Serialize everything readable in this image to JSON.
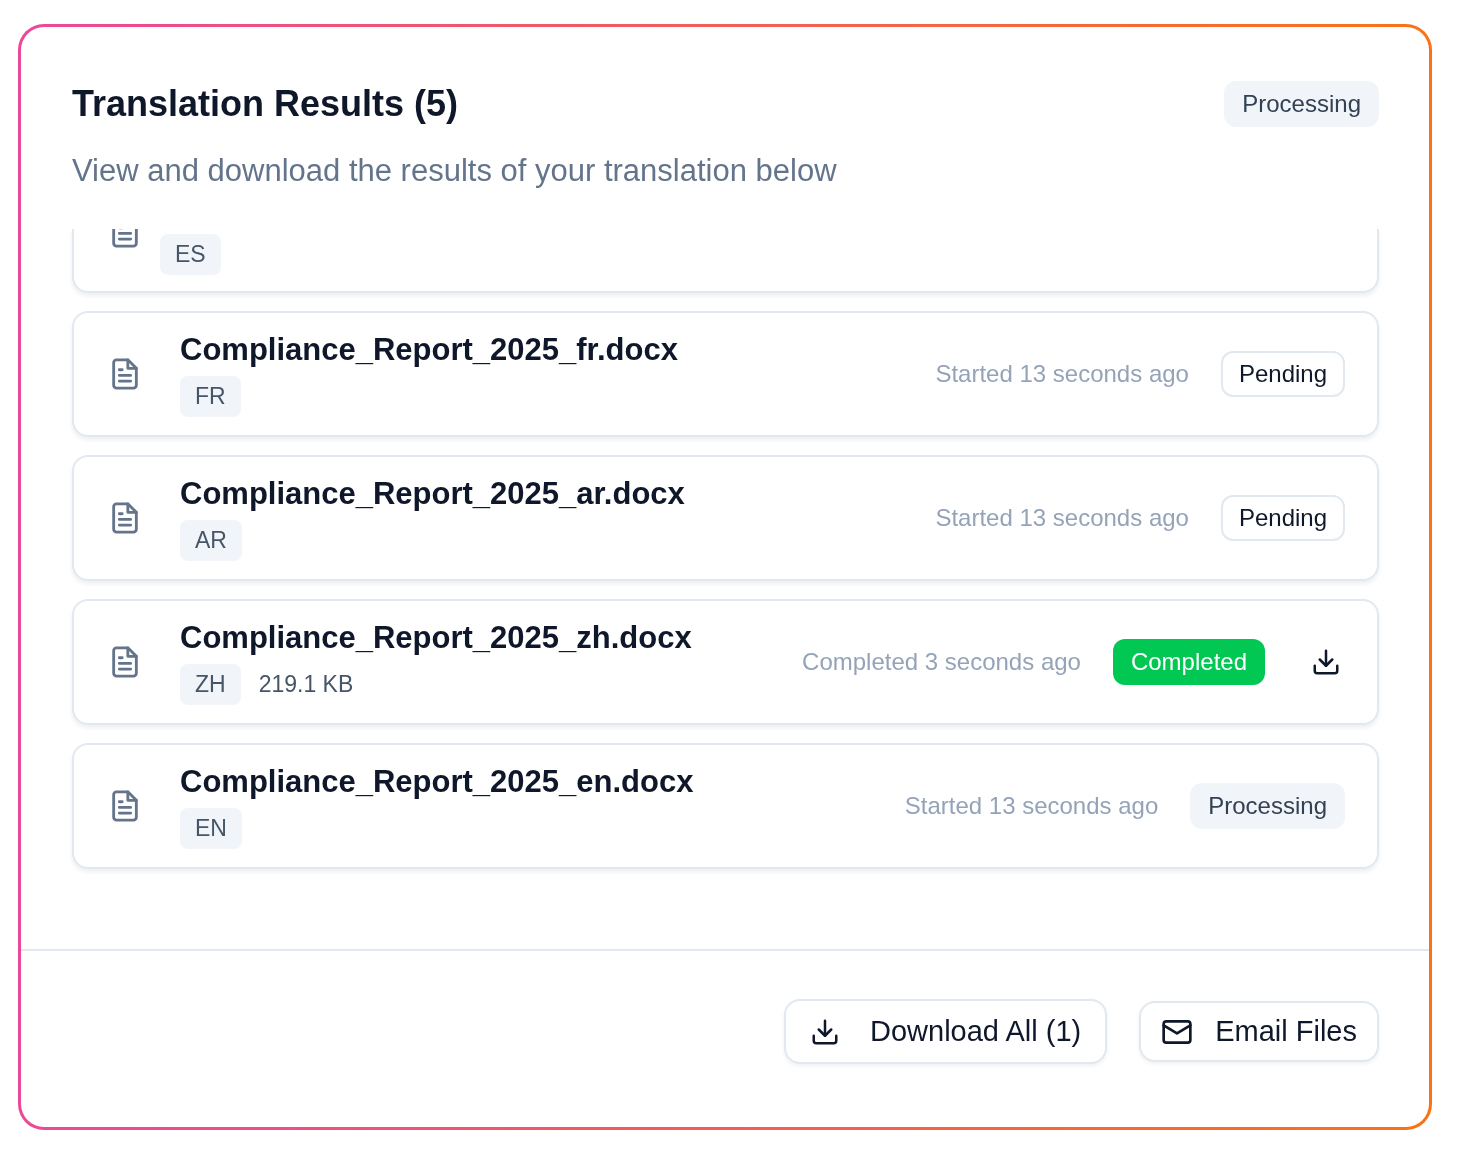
{
  "header": {
    "title": "Translation Results (5)",
    "subtitle": "View and download the results of your translation below",
    "status": "Processing"
  },
  "results": [
    {
      "kind": "partial",
      "language": "ES"
    },
    {
      "kind": "pending",
      "filename": "Compliance_Report_2025_fr.docx",
      "language": "FR",
      "time": "Started 13 seconds ago",
      "status": "Pending",
      "downloadable": false
    },
    {
      "kind": "pending",
      "filename": "Compliance_Report_2025_ar.docx",
      "language": "AR",
      "time": "Started 13 seconds ago",
      "status": "Pending",
      "downloadable": false
    },
    {
      "kind": "completed",
      "filename": "Compliance_Report_2025_zh.docx",
      "language": "ZH",
      "size": "219.1 KB",
      "time": "Completed 3 seconds ago",
      "status": "Completed",
      "downloadable": true
    },
    {
      "kind": "processing",
      "filename": "Compliance_Report_2025_en.docx",
      "language": "EN",
      "time": "Started 13 seconds ago",
      "status": "Processing",
      "downloadable": false
    }
  ],
  "footer": {
    "buttons": [
      "Download All (1)",
      "Email Files"
    ]
  }
}
